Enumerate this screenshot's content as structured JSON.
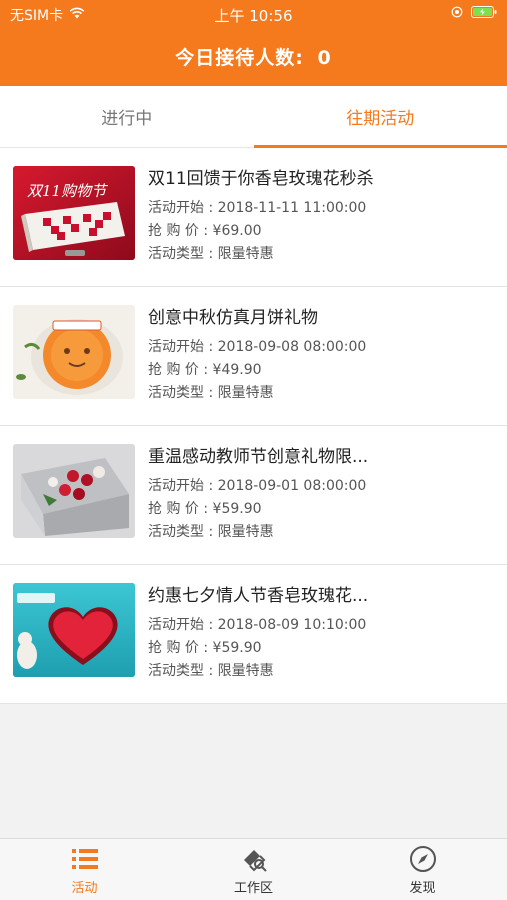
{
  "status_bar": {
    "carrier": "无SIM卡",
    "time": "上午 10:56"
  },
  "header": {
    "title_prefix": "今日接待人数:",
    "count": "0"
  },
  "tabs": [
    {
      "label": "进行中",
      "active": false
    },
    {
      "label": "往期活动",
      "active": true
    }
  ],
  "items": [
    {
      "name": "双11回馈于你香皂玫瑰花秒杀",
      "start_label": "活动开始 : ",
      "start_time": "2018-11-11 11:00:00",
      "price_label": "抢 购 价 : ",
      "price": "¥69.00",
      "type_label": "活动类型 : ",
      "type": "限量特惠",
      "image_text": "双11购物节"
    },
    {
      "name": "创意中秋仿真月饼礼物",
      "start_label": "活动开始 : ",
      "start_time": "2018-09-08 08:00:00",
      "price_label": "抢 购 价 : ",
      "price": "¥49.90",
      "type_label": "活动类型 : ",
      "type": "限量特惠"
    },
    {
      "name": "重温感动教师节创意礼物限...",
      "start_label": "活动开始 : ",
      "start_time": "2018-09-01 08:00:00",
      "price_label": "抢 购 价 : ",
      "price": "¥59.90",
      "type_label": "活动类型 : ",
      "type": "限量特惠"
    },
    {
      "name": "约惠七夕情人节香皂玫瑰花...",
      "start_label": "活动开始 : ",
      "start_time": "2018-08-09 10:10:00",
      "price_label": "抢 购 价 : ",
      "price": "¥59.90",
      "type_label": "活动类型 : ",
      "type": "限量特惠"
    }
  ],
  "tabbar": [
    {
      "label": "活动",
      "icon": "list-icon",
      "active": true
    },
    {
      "label": "工作区",
      "icon": "workspace-icon",
      "active": false
    },
    {
      "label": "发现",
      "icon": "compass-icon",
      "active": false
    }
  ],
  "colors": {
    "accent": "#f5791d",
    "background": "#f2f2f2"
  }
}
